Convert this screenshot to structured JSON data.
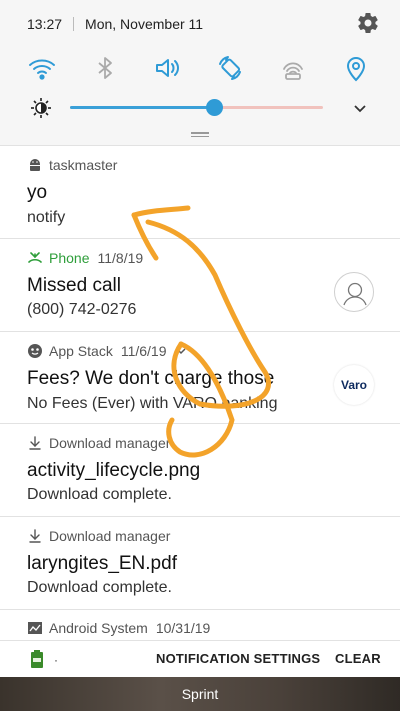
{
  "status": {
    "time": "13:27",
    "date": "Mon, November 11"
  },
  "colors": {
    "accent": "#2f9bd6",
    "annotation": "#f3a32a",
    "phone_green": "#2e9e3a"
  },
  "toggles": [
    {
      "name": "wifi-icon"
    },
    {
      "name": "bluetooth-icon"
    },
    {
      "name": "sound-icon"
    },
    {
      "name": "auto-rotate-icon"
    },
    {
      "name": "mobile-hotspot-icon"
    },
    {
      "name": "location-icon"
    }
  ],
  "brightness": {
    "level": 0.57
  },
  "notifications": [
    {
      "app": "taskmaster",
      "time": "",
      "title": "yo",
      "body": "notify"
    },
    {
      "app": "Phone",
      "time": "11/8/19",
      "title": "Missed call",
      "body": "(800) 742-0276"
    },
    {
      "app": "App Stack",
      "time": "11/6/19",
      "title": "Fees? We don't charge those",
      "body": "No Fees (Ever) with VARO banking",
      "badge": "Varo"
    },
    {
      "app": "Download manager",
      "time": "",
      "title": "activity_lifecycle.png",
      "body": "Download complete."
    },
    {
      "app": "Download manager",
      "time": "",
      "title": "laryngites_EN.pdf",
      "body": "Download complete."
    },
    {
      "app": "Android System",
      "time": "10/31/19",
      "title": "",
      "body": ""
    }
  ],
  "actions": {
    "dot": "·",
    "settings": "NOTIFICATION SETTINGS",
    "clear": "CLEAR"
  },
  "carrier": "Sprint"
}
